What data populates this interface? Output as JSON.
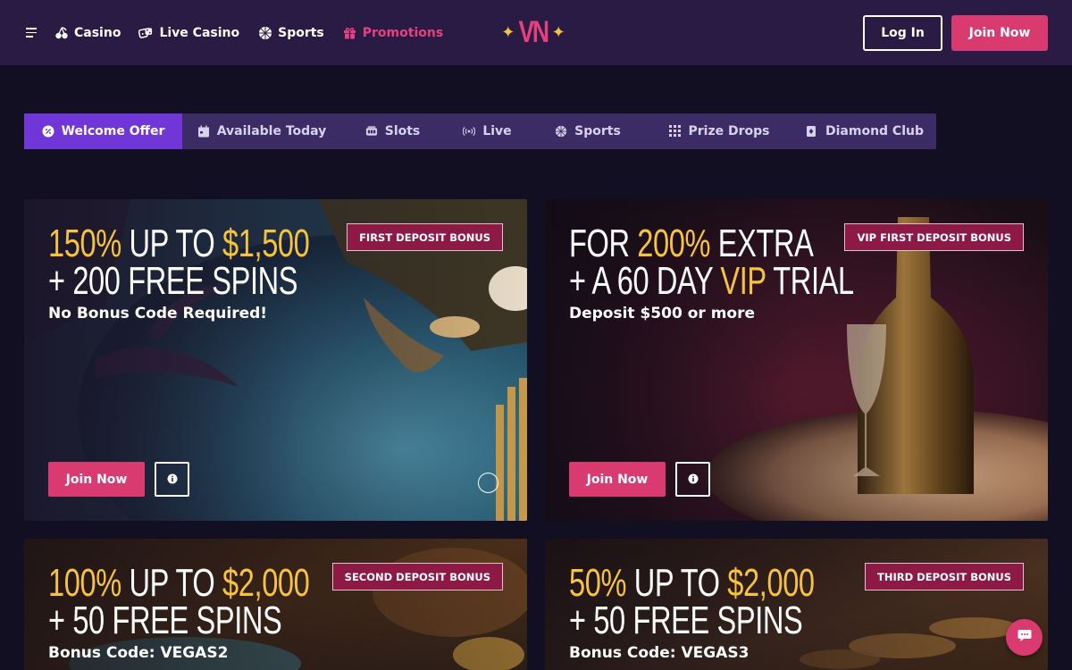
{
  "header": {
    "nav": [
      {
        "label": "Casino",
        "icon": "cherries-icon"
      },
      {
        "label": "Live Casino",
        "icon": "dice-icon"
      },
      {
        "label": "Sports",
        "icon": "sports-ball-icon"
      },
      {
        "label": "Promotions",
        "icon": "gift-icon",
        "active": true
      }
    ],
    "logo_text": "VN",
    "login_label": "Log In",
    "join_label": "Join Now"
  },
  "tabs": [
    {
      "label": "Welcome Offer",
      "icon": "percent-badge-icon",
      "active": true
    },
    {
      "label": "Available Today",
      "icon": "calendar-icon"
    },
    {
      "label": "Slots",
      "icon": "slot-machine-icon"
    },
    {
      "label": "Live",
      "icon": "broadcast-icon"
    },
    {
      "label": "Sports",
      "icon": "sports-ball-icon"
    },
    {
      "label": "Prize Drops",
      "icon": "grid-dots-icon"
    },
    {
      "label": "Diamond Club",
      "icon": "card-icon"
    }
  ],
  "promos": [
    {
      "line1_gold": "150%",
      "line1_mid": " UP TO ",
      "line1_gold2": "$1,500",
      "line2": "+ 200 FREE SPINS",
      "sub_text": "No Bonus Code Required!",
      "sub_code": "",
      "badge": "FIRST DEPOSIT BONUS",
      "join_label": "Join Now"
    },
    {
      "line1_pre": "FOR ",
      "line1_gold": "200%",
      "line1_post": " EXTRA",
      "line2_pre": "+ A 60 DAY ",
      "line2_gold": "VIP",
      "line2_post": " TRIAL",
      "sub_text": "Deposit $500 or more",
      "sub_code": "",
      "badge": "VIP FIRST DEPOSIT BONUS",
      "join_label": "Join Now"
    },
    {
      "line1_gold": "100%",
      "line1_mid": " UP TO ",
      "line1_gold2": "$2,000",
      "line2": "+ 50 FREE SPINS",
      "sub_text": "Bonus Code: ",
      "sub_code": "VEGAS2",
      "badge": "SECOND DEPOSIT BONUS"
    },
    {
      "line1_gold": "50%",
      "line1_mid": " UP TO ",
      "line1_gold2": "$2,000",
      "line2": "+ 50 FREE SPINS",
      "sub_text": "Bonus Code: ",
      "sub_code": "VEGAS3",
      "badge": "THIRD DEPOSIT BONUS"
    }
  ],
  "colors": {
    "brand_pink": "#d93a70",
    "gold": "#f6c33a",
    "active_tab": "#7136d8",
    "header_bg": "#2a1b45"
  }
}
